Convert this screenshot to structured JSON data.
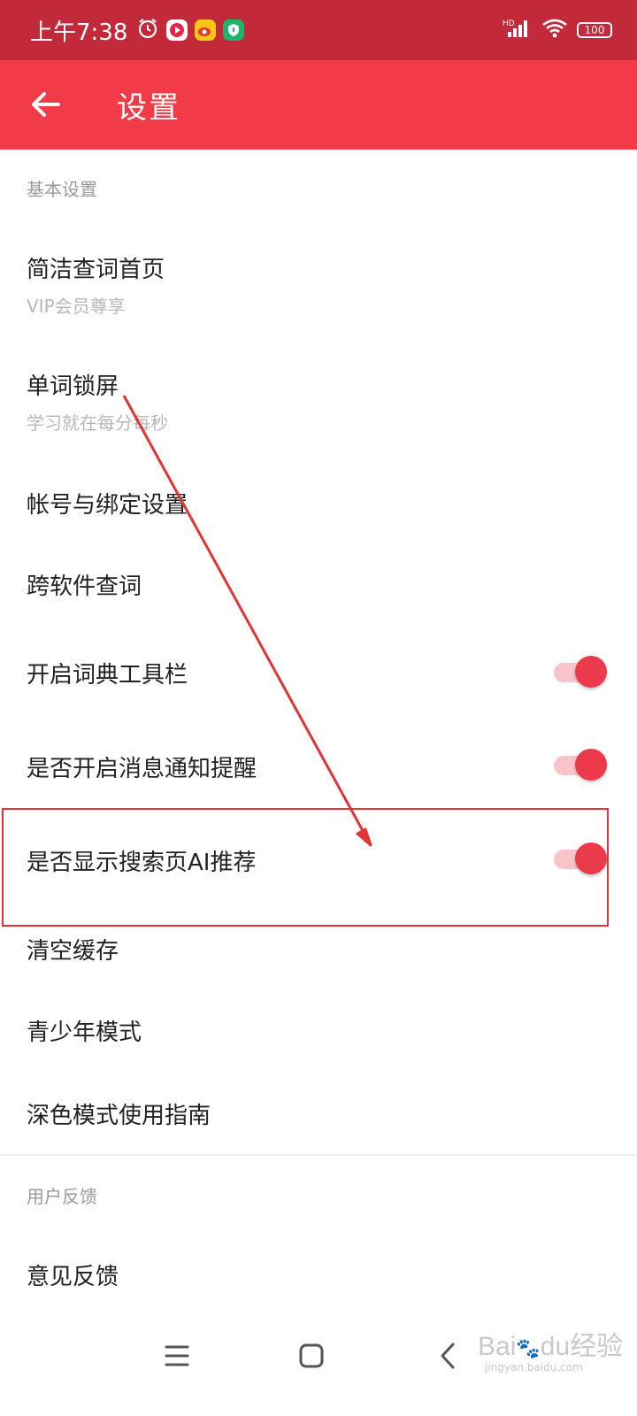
{
  "status_bar": {
    "time": "上午7:38",
    "network": "HD",
    "battery": "100"
  },
  "app_bar": {
    "title": "设置"
  },
  "sections": [
    {
      "header": "基本设置",
      "items": [
        {
          "title": "简洁查词首页",
          "subtitle": "VIP会员尊享"
        },
        {
          "title": "单词锁屏",
          "subtitle": "学习就在每分每秒"
        },
        {
          "title": "帐号与绑定设置"
        },
        {
          "title": "跨软件查词"
        },
        {
          "title": "开启词典工具栏",
          "toggle": true
        },
        {
          "title": "是否开启消息通知提醒",
          "toggle": true
        },
        {
          "title": "是否显示搜索页AI推荐",
          "toggle": true
        },
        {
          "title": "清空缓存"
        },
        {
          "title": "青少年模式"
        },
        {
          "title": "深色模式使用指南"
        }
      ]
    },
    {
      "header": "用户反馈",
      "items": [
        {
          "title": "意见反馈"
        }
      ]
    }
  ],
  "watermark": {
    "logo_a": "Bai",
    "logo_b": "du",
    "logo_c": "经验",
    "url": "jingyan.baidu.com"
  },
  "colors": {
    "status_bar": "#c22a3a",
    "app_bar": "#f23a48",
    "accent": "#ea3a4c",
    "annotation": "#e23434"
  },
  "icons": {
    "back": "arrow-left-icon",
    "menu": "menu-icon",
    "home": "home-icon",
    "nav_back": "chevron-left-icon"
  }
}
